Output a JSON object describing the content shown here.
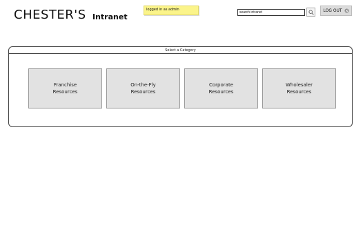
{
  "header": {
    "brand": "CHESTER'S",
    "subtitle": "Intranet",
    "status_note": "logged in as admin",
    "search": {
      "value": "search intranet",
      "button_icon": "search-icon"
    },
    "logout": {
      "label": "LOG OUT",
      "icon": "close-circle-icon"
    }
  },
  "panel": {
    "title": "Select a Category",
    "tiles": [
      {
        "line1": "Franchise",
        "line2": "Resources"
      },
      {
        "line1": "On-the-Fly",
        "line2": "Resources"
      },
      {
        "line1": "Corporate",
        "line2": "Resources"
      },
      {
        "line1": "Wholesaler",
        "line2": "Resources"
      }
    ]
  },
  "colors": {
    "note_yellow": "#fbf48a",
    "tile_gray": "#e2e2e2",
    "button_gray": "#dcdcdc"
  }
}
